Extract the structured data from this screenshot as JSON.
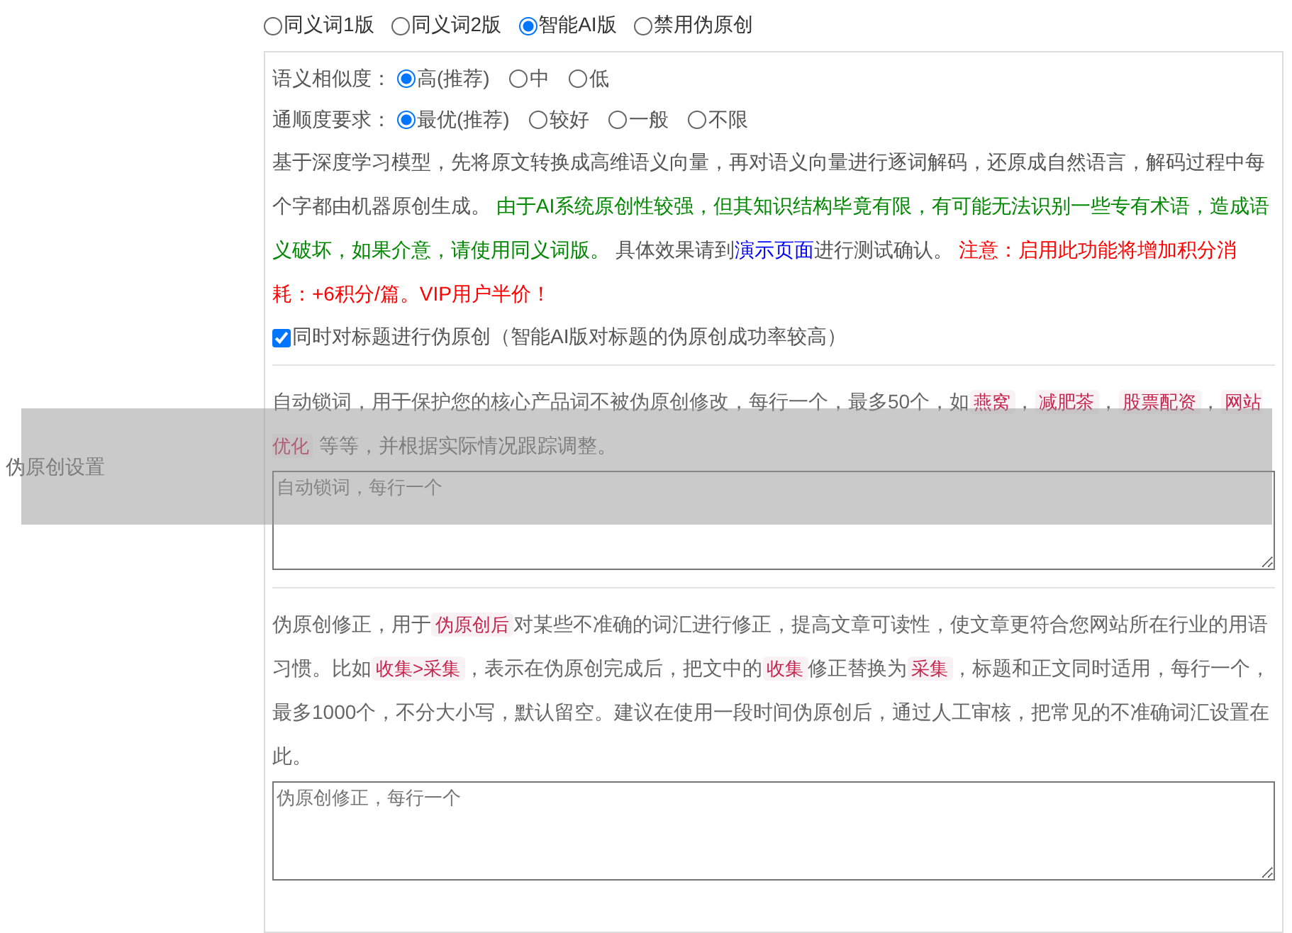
{
  "section_label": "伪原创设置",
  "modes": [
    {
      "label": "同义词1版",
      "selected": false
    },
    {
      "label": "同义词2版",
      "selected": false
    },
    {
      "label": "智能AI版",
      "selected": true
    },
    {
      "label": "禁用伪原创",
      "selected": false
    }
  ],
  "similarity": {
    "label": "语义相似度：",
    "options": [
      {
        "label": "高(推荐)",
        "selected": true
      },
      {
        "label": "中",
        "selected": false
      },
      {
        "label": "低",
        "selected": false
      }
    ]
  },
  "fluency": {
    "label": "通顺度要求：",
    "options": [
      {
        "label": "最优(推荐)",
        "selected": true
      },
      {
        "label": "较好",
        "selected": false
      },
      {
        "label": "一般",
        "selected": false
      },
      {
        "label": "不限",
        "selected": false
      }
    ]
  },
  "description": [
    {
      "kind": "text",
      "text": "基于深度学习模型，先将原文转换成高维语义向量，再对语义向量进行逐词解码，还原成自然语言，解码过程中每个字都由机器原创生成。 "
    },
    {
      "kind": "note",
      "text": "由于AI系统原创性较强，但其知识结构毕竟有限，有可能无法识别一些专有术语，造成语义破坏，如果介意，请使用同义词版。"
    },
    {
      "kind": "text",
      "text": " 具体效果请到"
    },
    {
      "kind": "link",
      "text": "演示页面"
    },
    {
      "kind": "text",
      "text": "进行测试确认。 "
    },
    {
      "kind": "warning",
      "text": "注意：启用此功能将增加积分消耗：+6积分/篇。VIP用户半价！"
    }
  ],
  "title_option": {
    "label": "同时对标题进行伪原创（智能AI版对标题的伪原创成功率较高）",
    "checked": true
  },
  "lock_words": {
    "description": [
      {
        "kind": "text",
        "text": "自动锁词，用于保护您的核心产品词不被伪原创修改，每行一个，最多50个，如"
      },
      {
        "kind": "code",
        "text": "燕窝"
      },
      {
        "kind": "text",
        "text": "，"
      },
      {
        "kind": "code",
        "text": "减肥茶"
      },
      {
        "kind": "text",
        "text": "，"
      },
      {
        "kind": "code",
        "text": "股票配资"
      },
      {
        "kind": "text",
        "text": "，"
      },
      {
        "kind": "code",
        "text": "网站优化"
      },
      {
        "kind": "text",
        "text": " 等等，并根据实际情况跟踪调整。"
      }
    ],
    "placeholder": "自动锁词，每行一个"
  },
  "corrections": {
    "description": [
      {
        "kind": "text",
        "text": "伪原创修正，用于"
      },
      {
        "kind": "code",
        "text": "伪原创后"
      },
      {
        "kind": "text",
        "text": "对某些不准确的词汇进行修正，提高文章可读性，使文章更符合您网站所在行业的用语习惯。比如"
      },
      {
        "kind": "code",
        "text": "收集>采集"
      },
      {
        "kind": "text",
        "text": "，表示在伪原创完成后，把文中的"
      },
      {
        "kind": "code",
        "text": "收集"
      },
      {
        "kind": "text",
        "text": "修正替换为"
      },
      {
        "kind": "code",
        "text": "采集"
      },
      {
        "kind": "text",
        "text": "，标题和正文同时适用，每行一个，最多1000个，不分大小写，默认留空。建议在使用一段时间伪原创后，通过人工审核，把常见的不准确词汇设置在此。"
      }
    ],
    "placeholder": "伪原创修正，每行一个"
  }
}
